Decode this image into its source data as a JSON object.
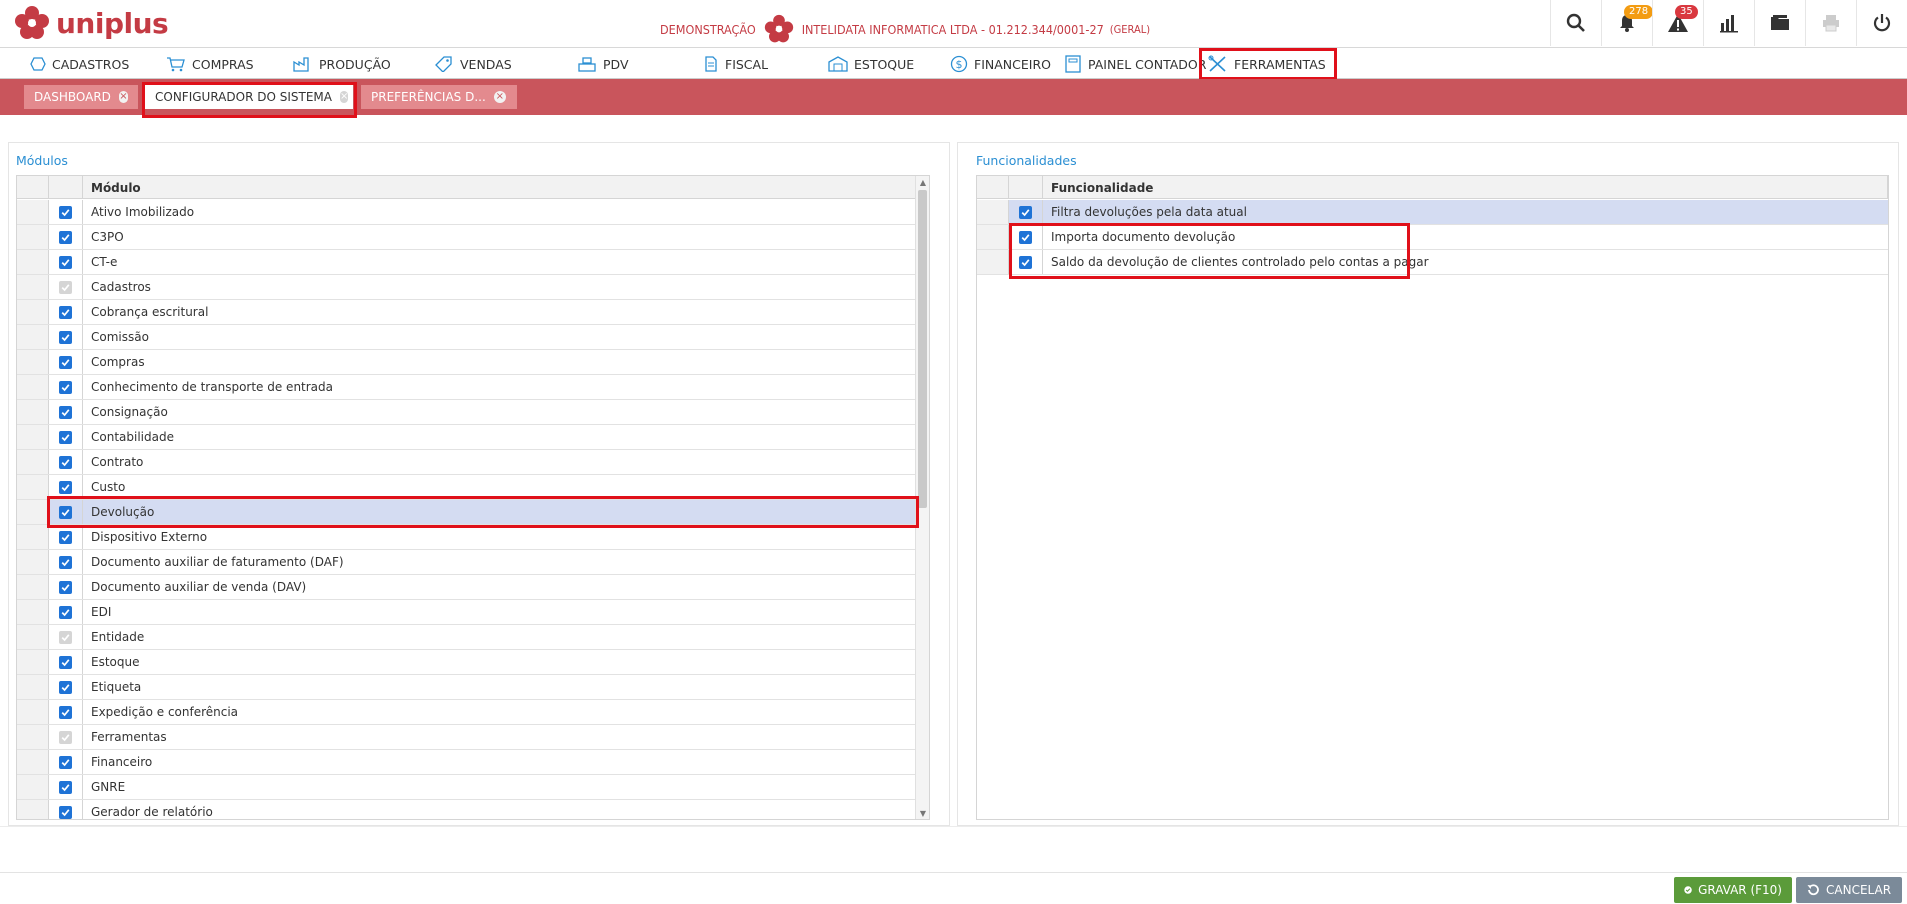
{
  "app": {
    "logo_text": "uniplus",
    "environment_label": "DEMONSTRAÇÃO",
    "company_name": "INTELIDATA INFORMATICA LTDA - 01.212.344/0001-27",
    "company_scope": "(GERAL)",
    "brand_color": "#c43b44"
  },
  "top_icons": {
    "notifications_count": "278",
    "alerts_count": "35",
    "icons": [
      "search-icon",
      "bell-icon",
      "warning-icon",
      "chart-icon",
      "folder-icon",
      "printer-icon",
      "power-icon"
    ]
  },
  "menu": [
    {
      "label": "CADASTROS",
      "icon": "hexagon-icon"
    },
    {
      "label": "COMPRAS",
      "icon": "cart-icon"
    },
    {
      "label": "PRODUÇÃO",
      "icon": "factory-icon"
    },
    {
      "label": "VENDAS",
      "icon": "tag-icon"
    },
    {
      "label": "PDV",
      "icon": "cash-register-icon"
    },
    {
      "label": "FISCAL",
      "icon": "document-icon"
    },
    {
      "label": "ESTOQUE",
      "icon": "warehouse-icon"
    },
    {
      "label": "FINANCEIRO",
      "icon": "dollar-icon"
    },
    {
      "label": "PAINEL CONTADOR",
      "icon": "calculator-icon"
    },
    {
      "label": "FERRAMENTAS",
      "icon": "tools-icon"
    }
  ],
  "tabs": [
    {
      "label": "DASHBOARD"
    },
    {
      "label": "CONFIGURADOR DO SISTEMA"
    },
    {
      "label": "PREFERÊNCIAS D..."
    }
  ],
  "modules_panel": {
    "title": "Módulos",
    "column_header": "Módulo",
    "rows": [
      {
        "label": "Ativo Imobilizado",
        "checked": true,
        "disabled": false
      },
      {
        "label": "C3PO",
        "checked": true,
        "disabled": false
      },
      {
        "label": "CT-e",
        "checked": true,
        "disabled": false
      },
      {
        "label": "Cadastros",
        "checked": true,
        "disabled": true
      },
      {
        "label": "Cobrança escritural",
        "checked": true,
        "disabled": false
      },
      {
        "label": "Comissão",
        "checked": true,
        "disabled": false
      },
      {
        "label": "Compras",
        "checked": true,
        "disabled": false
      },
      {
        "label": "Conhecimento de transporte de entrada",
        "checked": true,
        "disabled": false
      },
      {
        "label": "Consignação",
        "checked": true,
        "disabled": false
      },
      {
        "label": "Contabilidade",
        "checked": true,
        "disabled": false
      },
      {
        "label": "Contrato",
        "checked": true,
        "disabled": false
      },
      {
        "label": "Custo",
        "checked": true,
        "disabled": false
      },
      {
        "label": "Devolução",
        "checked": true,
        "disabled": false,
        "selected": true
      },
      {
        "label": "Dispositivo Externo",
        "checked": true,
        "disabled": false
      },
      {
        "label": "Documento auxiliar de faturamento (DAF)",
        "checked": true,
        "disabled": false
      },
      {
        "label": "Documento auxiliar de venda (DAV)",
        "checked": true,
        "disabled": false
      },
      {
        "label": "EDI",
        "checked": true,
        "disabled": false
      },
      {
        "label": "Entidade",
        "checked": true,
        "disabled": true
      },
      {
        "label": "Estoque",
        "checked": true,
        "disabled": false
      },
      {
        "label": "Etiqueta",
        "checked": true,
        "disabled": false
      },
      {
        "label": "Expedição e conferência",
        "checked": true,
        "disabled": false
      },
      {
        "label": "Ferramentas",
        "checked": true,
        "disabled": true
      },
      {
        "label": "Financeiro",
        "checked": true,
        "disabled": false
      },
      {
        "label": "GNRE",
        "checked": true,
        "disabled": false
      },
      {
        "label": "Gerador de relatório",
        "checked": true,
        "disabled": false
      }
    ]
  },
  "features_panel": {
    "title": "Funcionalidades",
    "column_header": "Funcionalidade",
    "rows": [
      {
        "label": "Filtra devoluções pela data atual",
        "checked": true,
        "selected": true
      },
      {
        "label": "Importa documento devolução",
        "checked": true
      },
      {
        "label": "Saldo da devolução de clientes controlado pelo contas a pagar",
        "checked": true
      }
    ]
  },
  "footer": {
    "save_label": "GRAVAR (F10)",
    "cancel_label": "CANCELAR"
  }
}
